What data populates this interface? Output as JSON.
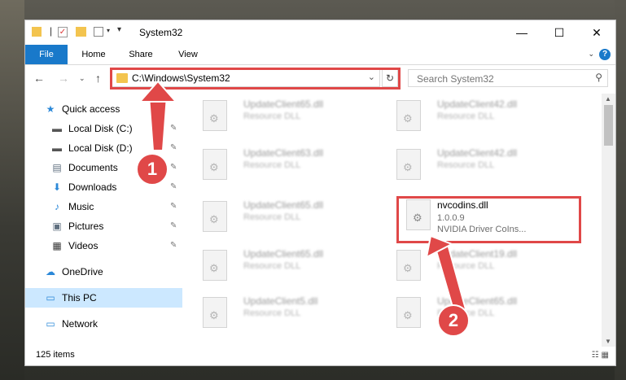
{
  "window": {
    "title": "System32",
    "controls": {
      "minimize": "—",
      "maximize": "☐",
      "close": "✕"
    }
  },
  "ribbon": {
    "tabs": [
      "File",
      "Home",
      "Share",
      "View"
    ],
    "help": "?"
  },
  "nav": {
    "address_path": "C:\\Windows\\System32",
    "search_placeholder": "Search System32"
  },
  "sidebar": {
    "items": [
      {
        "label": "Quick access",
        "icon": "star-icon",
        "pinned": false,
        "selected": false
      },
      {
        "label": "Local Disk (C:)",
        "icon": "drive-icon",
        "pinned": true,
        "selected": false
      },
      {
        "label": "Local Disk (D:)",
        "icon": "drive-icon",
        "pinned": true,
        "selected": false
      },
      {
        "label": "Documents",
        "icon": "document-icon",
        "pinned": true,
        "selected": false
      },
      {
        "label": "Downloads",
        "icon": "download-icon",
        "pinned": true,
        "selected": false
      },
      {
        "label": "Music",
        "icon": "music-icon",
        "pinned": true,
        "selected": false
      },
      {
        "label": "Pictures",
        "icon": "pictures-icon",
        "pinned": true,
        "selected": false
      },
      {
        "label": "Videos",
        "icon": "video-icon",
        "pinned": true,
        "selected": false
      },
      {
        "label": "OneDrive",
        "icon": "cloud-icon",
        "pinned": false,
        "selected": false
      },
      {
        "label": "This PC",
        "icon": "computer-icon",
        "pinned": false,
        "selected": true
      },
      {
        "label": "Network",
        "icon": "network-icon",
        "pinned": false,
        "selected": false
      }
    ]
  },
  "files": [
    {
      "name": "UpdateClient65.dll",
      "desc": "Resource DLL"
    },
    {
      "name": "UpdateClient42.dll",
      "desc": "Resource DLL"
    },
    {
      "name": "UpdateClient63.dll",
      "desc": "Resource DLL"
    },
    {
      "name": "UpdateClient42.dll",
      "desc": "Resource DLL"
    },
    {
      "name": "UpdateClient65.dll",
      "desc": "Resource DLL"
    },
    {
      "name": "nvcodins.dll",
      "version": "1.0.0.9",
      "desc": "NVIDIA Driver CoIns...",
      "highlighted": true
    },
    {
      "name": "UpdateClient65.dll",
      "desc": "Resource DLL"
    },
    {
      "name": "UpdateClient19.dll",
      "desc": "Resource DLL"
    },
    {
      "name": "UpdateClient5.dll",
      "desc": "Resource DLL"
    },
    {
      "name": "UpdateClient65.dll",
      "desc": "Resource DLL"
    }
  ],
  "status": {
    "item_count": "125 items"
  },
  "annotations": {
    "badge1": "1",
    "badge2": "2"
  },
  "colors": {
    "accent": "#1979ca",
    "highlight": "#e04848",
    "selected": "#cce8ff"
  }
}
